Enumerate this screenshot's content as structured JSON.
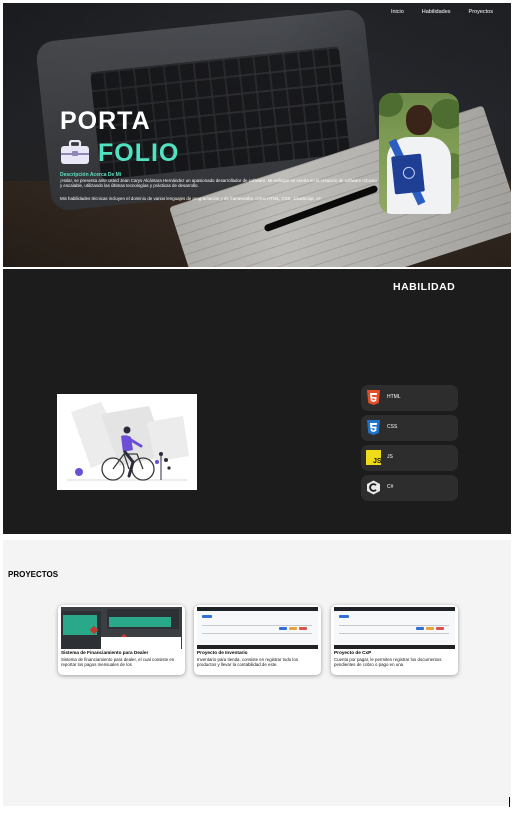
{
  "nav": {
    "items": [
      "Inicio",
      "Habilidades",
      "Proyectos"
    ]
  },
  "hero": {
    "title_top": "PORTA",
    "title_bottom": "FOLIO",
    "about_heading": "Descripción Acerca De Mi",
    "about_text": "¡Hola!, se presenta ante usted Jean Carys Alcántara Hernández un apasionado desarrollador de software. Mi enfoque se centra en la creación de software robusto y escalable, utilizando las últimas tecnologías y prácticas de desarrollo.",
    "skills_text": "Mis habilidades técnicas incluyen el dominio de varios lenguajes de programación y de frameworks, como HTML, CSS, JavaScript, c#",
    "accent_color": "#4fe3c1"
  },
  "skills": {
    "title": "HABILIDAD",
    "items": [
      {
        "label": "HTML",
        "icon": "html5-icon",
        "color": "#e44d26"
      },
      {
        "label": "CSS",
        "icon": "css3-icon",
        "color": "#1f73c9"
      },
      {
        "label": "JS",
        "icon": "js-icon",
        "color": "#f0db1a"
      },
      {
        "label": "C#",
        "icon": "csharp-icon",
        "color": "#e8e8e8"
      }
    ]
  },
  "projects": {
    "title": "PROYECTOS",
    "items": [
      {
        "title": "Sistema de Financiamiento para Dealer",
        "description": "Sistema de financiamiento para dealer, el cual consiste en reportar los pagos mensuales de los"
      },
      {
        "title": "Proyecto de Inventario",
        "description": "Inventario para tienda, consiste en registrar todo los productos y llevar la contabilidad de este."
      },
      {
        "title": "Proyecto de CxP",
        "description": "Cuenta por pagar, le permiten registrar los documentos pendientes de cobro o pago en una"
      }
    ]
  }
}
